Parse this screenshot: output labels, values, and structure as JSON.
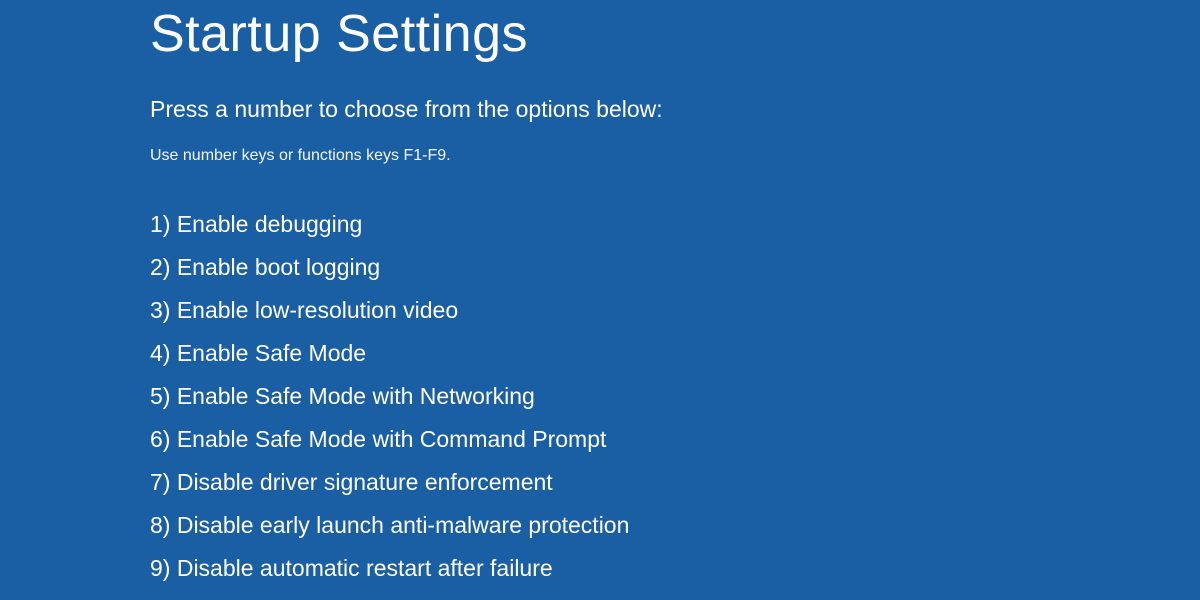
{
  "title": "Startup Settings",
  "instruction": "Press a number to choose from the options below:",
  "hint": "Use number keys or functions keys F1-F9.",
  "options": [
    "1) Enable debugging",
    "2) Enable boot logging",
    "3) Enable low-resolution video",
    "4) Enable Safe Mode",
    "5) Enable Safe Mode with Networking",
    "6) Enable Safe Mode with Command Prompt",
    "7) Disable driver signature enforcement",
    "8) Disable early launch anti-malware protection",
    "9) Disable automatic restart after failure"
  ],
  "colors": {
    "background": "#1a5ea3",
    "text": "#ffffff"
  }
}
